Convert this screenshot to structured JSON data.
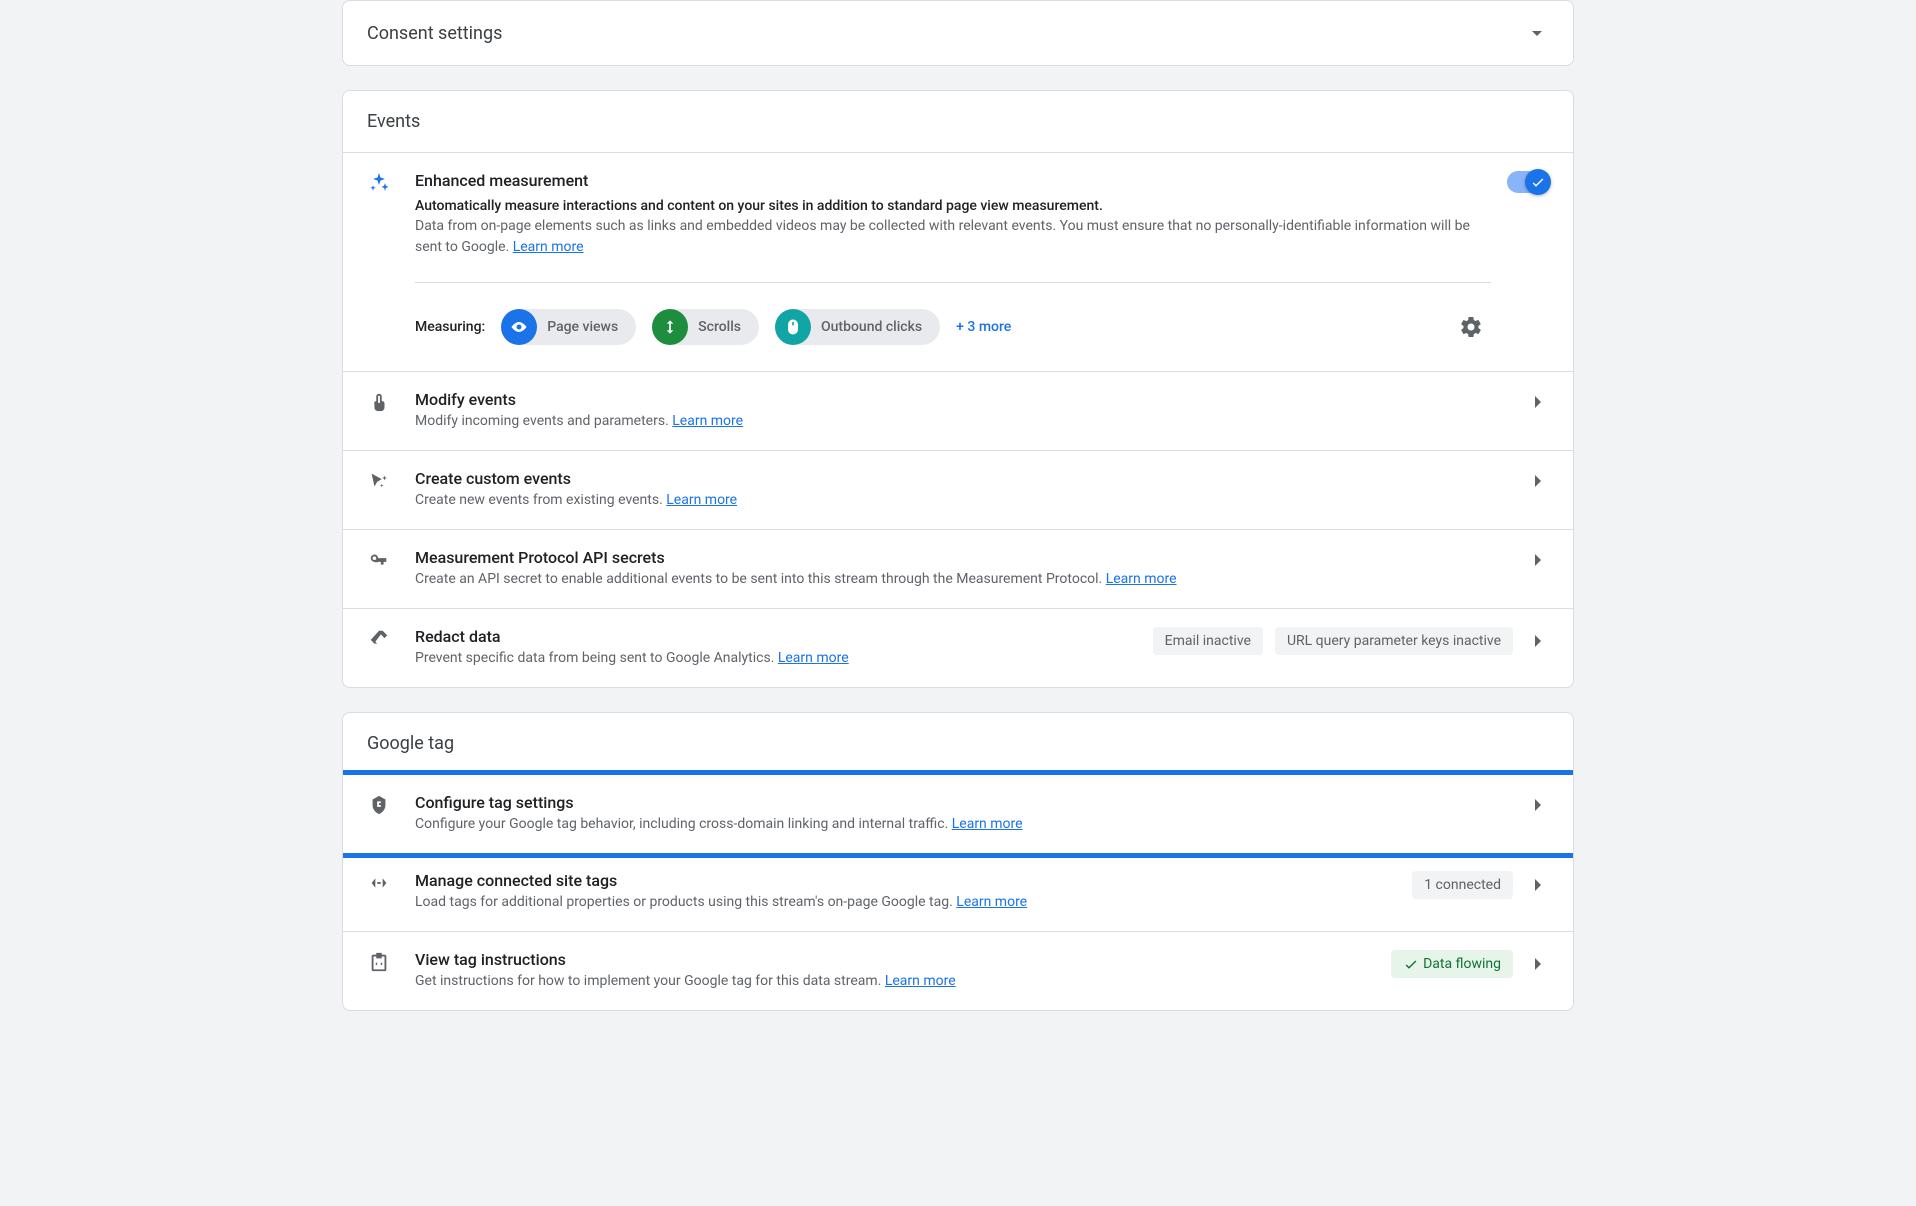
{
  "consent": {
    "title": "Consent settings"
  },
  "events": {
    "title": "Events",
    "enhanced": {
      "title": "Enhanced measurement",
      "bold_line": "Automatically measure interactions and content on your sites in addition to standard page view measurement.",
      "desc": "Data from on-page elements such as links and embedded videos may be collected with relevant events. You must ensure that no personally-identifiable information will be sent to Google. ",
      "learn_more": "Learn more",
      "measuring_label": "Measuring:",
      "pills": {
        "page_views": "Page views",
        "scrolls": "Scrolls",
        "outbound": "Outbound clicks"
      },
      "more": "+ 3 more"
    },
    "modify": {
      "title": "Modify events",
      "desc": "Modify incoming events and parameters. ",
      "learn_more": "Learn more"
    },
    "custom": {
      "title": "Create custom events",
      "desc": "Create new events from existing events. ",
      "learn_more": "Learn more"
    },
    "api": {
      "title": "Measurement Protocol API secrets",
      "desc": "Create an API secret to enable additional events to be sent into this stream through the Measurement Protocol. ",
      "learn_more": "Learn more"
    },
    "redact": {
      "title": "Redact data",
      "desc": "Prevent specific data from being sent to Google Analytics. ",
      "learn_more": "Learn more",
      "tags": {
        "email": "Email inactive",
        "url": "URL query parameter keys inactive"
      }
    }
  },
  "googletag": {
    "title": "Google tag",
    "configure": {
      "title": "Configure tag settings",
      "desc": "Configure your Google tag behavior, including cross-domain linking and internal traffic. ",
      "learn_more": "Learn more"
    },
    "connected": {
      "title": "Manage connected site tags",
      "desc": "Load tags for additional properties or products using this stream's on-page Google tag. ",
      "learn_more": "Learn more",
      "badge": "1 connected"
    },
    "instructions": {
      "title": "View tag instructions",
      "desc": "Get instructions for how to implement your Google tag for this data stream. ",
      "learn_more": "Learn more",
      "badge": "Data flowing"
    }
  }
}
